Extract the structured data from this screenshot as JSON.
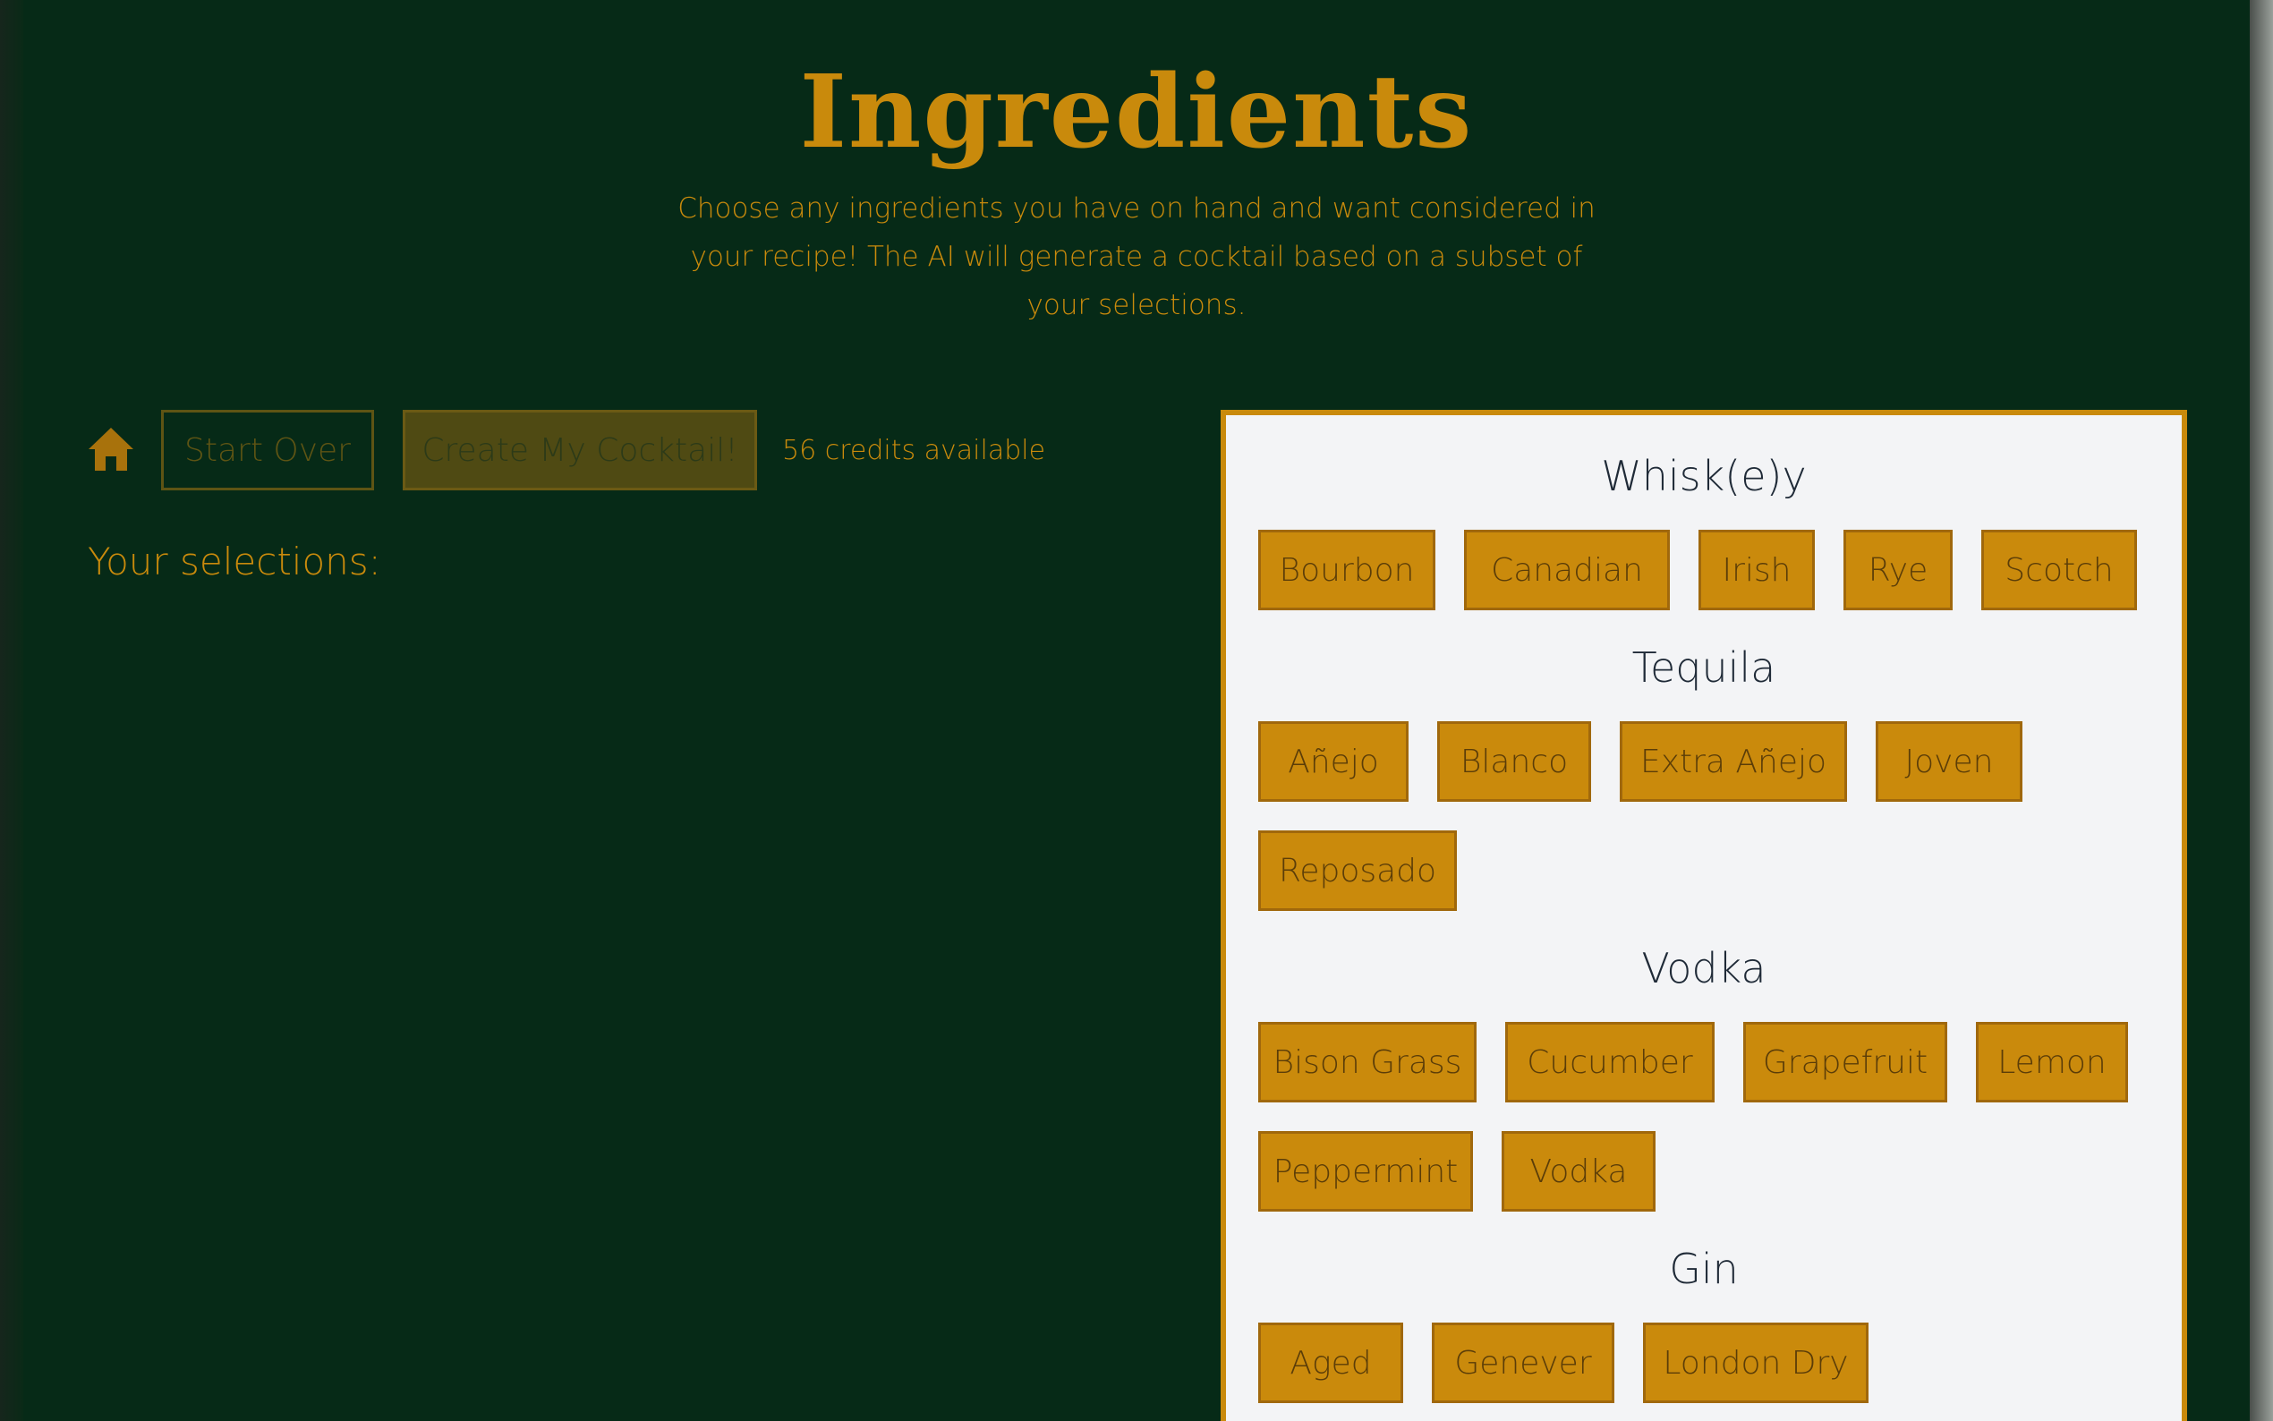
{
  "header": {
    "title": "Ingredients",
    "subtitle": "Choose any ingredients you have on hand and want considered in your recipe! The AI will generate a cocktail based on a subset of your selections."
  },
  "toolbar": {
    "home_icon": "home-icon",
    "start_over_label": "Start Over",
    "create_label": "Create My Cocktail!",
    "credits_text": "56 credits available"
  },
  "selections": {
    "label": "Your selections:"
  },
  "categories": [
    {
      "title": "Whisk(e)y",
      "items": [
        "Bourbon",
        "Canadian",
        "Irish",
        "Rye",
        "Scotch"
      ]
    },
    {
      "title": "Tequila",
      "items": [
        "Añejo",
        "Blanco",
        "Extra Añejo",
        "Joven",
        "Reposado"
      ]
    },
    {
      "title": "Vodka",
      "items": [
        "Bison Grass",
        "Cucumber",
        "Grapefruit",
        "Lemon",
        "Peppermint",
        "Vodka"
      ]
    },
    {
      "title": "Gin",
      "items": [
        "Aged",
        "Genever",
        "London Dry"
      ]
    }
  ],
  "colors": {
    "background": "#062a17",
    "accent": "#c98a0c",
    "panel": "#f3f4f6",
    "panel_text": "#1f2a37"
  }
}
